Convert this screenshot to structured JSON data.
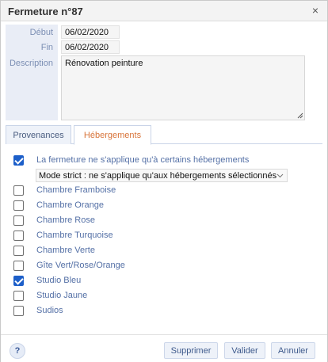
{
  "dialog": {
    "title": "Fermeture n°87",
    "close_glyph": "×"
  },
  "form": {
    "debut_label": "Début",
    "debut_value": "06/02/2020",
    "fin_label": "Fin",
    "fin_value": "06/02/2020",
    "description_label": "Description",
    "description_value": "Rénovation peinture"
  },
  "tabs": [
    {
      "label": "Provenances",
      "active": false
    },
    {
      "label": "Hébergements",
      "active": true
    }
  ],
  "hebergements": {
    "restrict_checkbox": {
      "label": "La fermeture ne s'applique qu'à certains hébergements",
      "checked": true
    },
    "mode_select": {
      "selected": "Mode strict : ne s'applique qu'aux hébergements sélectionnés"
    },
    "items": [
      {
        "label": "Chambre Framboise",
        "checked": false
      },
      {
        "label": "Chambre Orange",
        "checked": false
      },
      {
        "label": "Chambre Rose",
        "checked": false
      },
      {
        "label": "Chambre Turquoise",
        "checked": false
      },
      {
        "label": "Chambre Verte",
        "checked": false
      },
      {
        "label": "Gîte Vert/Rose/Orange",
        "checked": false
      },
      {
        "label": "Studio Bleu",
        "checked": true
      },
      {
        "label": "Studio Jaune",
        "checked": false
      },
      {
        "label": "Sudios",
        "checked": false
      }
    ]
  },
  "footer": {
    "help_label": "?",
    "supprimer_label": "Supprimer",
    "valider_label": "Valider",
    "annuler_label": "Annuler"
  },
  "colors": {
    "accent_tab": "#d8743a",
    "checkbox_checked": "#1d5fc9",
    "label_blue": "#5470a6"
  }
}
